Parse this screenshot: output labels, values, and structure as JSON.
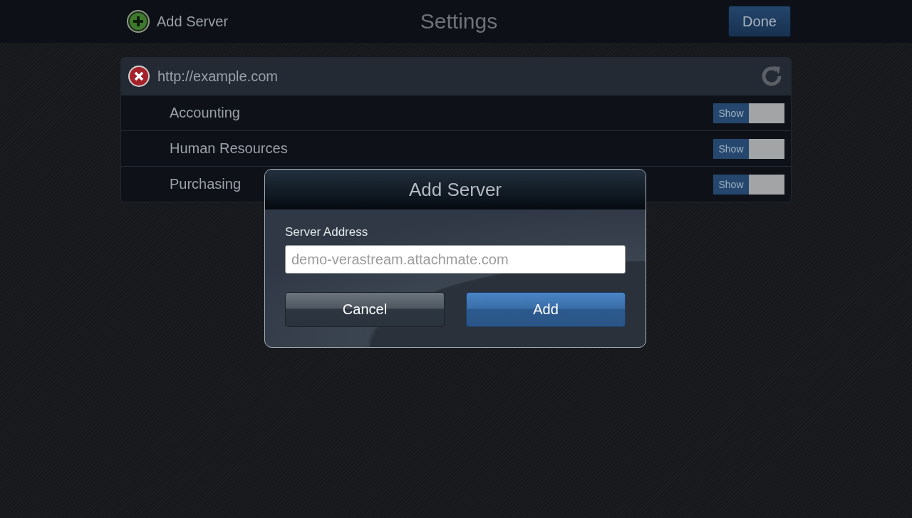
{
  "top_bar": {
    "add_button": "Add Server",
    "title": "Settings",
    "done_button": "Done"
  },
  "server": {
    "url": "http://example.com",
    "items": [
      {
        "name": "Accounting",
        "toggle_label": "Show",
        "on": true
      },
      {
        "name": "Human Resources",
        "toggle_label": "Show",
        "on": true
      },
      {
        "name": "Purchasing",
        "toggle_label": "Show",
        "on": true
      }
    ]
  },
  "dialog": {
    "title": "Add Server",
    "field_label": "Server Address",
    "placeholder": "demo-verastream.attachmate.com",
    "buttons": [
      {
        "label": "Cancel",
        "kind": "secondary"
      },
      {
        "label": "Add",
        "kind": "primary"
      }
    ]
  }
}
